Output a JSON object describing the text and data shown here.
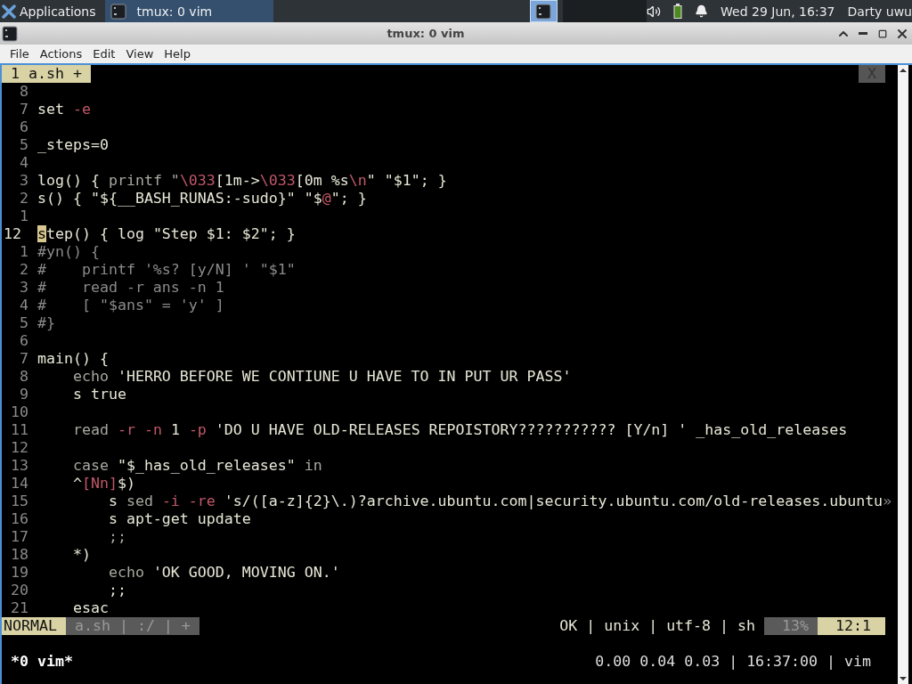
{
  "panel": {
    "app_menu": "Applications",
    "tasks": [
      {
        "label": "tmux: 0 vim",
        "selected": true
      }
    ],
    "clock": "Wed 29 Jun, 16:37",
    "user": "Darty uwu"
  },
  "window": {
    "title": "tmux: 0 vim"
  },
  "menu": [
    "File",
    "Actions",
    "Edit",
    "View",
    "Help"
  ],
  "vim": {
    "tabs": [
      {
        "label": "1 a.sh +",
        "selected": true
      }
    ],
    "close_tab": "X",
    "lines": [
      {
        "number": "8",
        "current": false
      },
      {
        "number": "7",
        "current": false,
        "segments": [
          {
            "kind": "text",
            "text": "set "
          },
          {
            "kind": "flag",
            "text": "-e"
          }
        ]
      },
      {
        "number": "6",
        "current": false
      },
      {
        "number": "5",
        "current": false,
        "segments": [
          {
            "kind": "text",
            "text": "_steps=0"
          }
        ]
      },
      {
        "number": "4",
        "current": false
      },
      {
        "number": "3",
        "current": false,
        "segments": [
          {
            "kind": "text",
            "text": "log() { "
          },
          {
            "kind": "builtin",
            "text": "printf \""
          },
          {
            "kind": "flag",
            "text": "\\033"
          },
          {
            "kind": "text",
            "text": "[1m->"
          },
          {
            "kind": "flag",
            "text": "\\033"
          },
          {
            "kind": "text",
            "text": "[0m %s"
          },
          {
            "kind": "flag",
            "text": "\\n"
          },
          {
            "kind": "text",
            "text": "\" \"$1\"; }"
          }
        ]
      },
      {
        "number": "2",
        "current": false,
        "segments": [
          {
            "kind": "text",
            "text": "s() { \"${__BASH_RUNAS:-sudo}\" \"$"
          },
          {
            "kind": "flag",
            "text": "@"
          },
          {
            "kind": "text",
            "text": "\"; }"
          }
        ]
      },
      {
        "number": "1",
        "current": false
      },
      {
        "number": "12",
        "current": true,
        "segments": [
          {
            "kind": "cursor",
            "text": "s"
          },
          {
            "kind": "text",
            "text": "tep() { log \"Step $1: $2\"; }"
          }
        ]
      },
      {
        "number": "1",
        "current": false,
        "segments": [
          {
            "kind": "comment",
            "text": "#yn() {"
          }
        ]
      },
      {
        "number": "2",
        "current": false,
        "segments": [
          {
            "kind": "comment",
            "text": "#    printf '%s? [y/N] ' \"$1\""
          }
        ]
      },
      {
        "number": "3",
        "current": false,
        "segments": [
          {
            "kind": "comment",
            "text": "#    read -r ans -n 1"
          }
        ]
      },
      {
        "number": "4",
        "current": false,
        "segments": [
          {
            "kind": "comment",
            "text": "#    [ \"$ans\" = 'y' ]"
          }
        ]
      },
      {
        "number": "5",
        "current": false,
        "segments": [
          {
            "kind": "comment",
            "text": "#}"
          }
        ]
      },
      {
        "number": "6",
        "current": false
      },
      {
        "number": "7",
        "current": false,
        "segments": [
          {
            "kind": "text",
            "text": "main() {"
          }
        ]
      },
      {
        "number": "8",
        "current": false,
        "segments": [
          {
            "kind": "builtin",
            "text": "    echo "
          },
          {
            "kind": "text",
            "text": "'HERRO BEFORE WE CONTIUNE U HAVE TO IN PUT UR PASS'"
          }
        ]
      },
      {
        "number": "9",
        "current": false,
        "segments": [
          {
            "kind": "text",
            "text": "    s true"
          }
        ]
      },
      {
        "number": "10",
        "current": false
      },
      {
        "number": "11",
        "current": false,
        "segments": [
          {
            "kind": "builtin",
            "text": "    read "
          },
          {
            "kind": "flag",
            "text": "-r "
          },
          {
            "kind": "flag",
            "text": "-n"
          },
          {
            "kind": "text",
            "text": " 1 "
          },
          {
            "kind": "flag",
            "text": "-p"
          },
          {
            "kind": "text",
            "text": " 'DO U HAVE OLD-RELEASES REPOISTORY??????????? [Y/n] ' _has_old_releases"
          }
        ]
      },
      {
        "number": "12",
        "current": false
      },
      {
        "number": "13",
        "current": false,
        "segments": [
          {
            "kind": "builtin",
            "text": "    case "
          },
          {
            "kind": "text",
            "text": "\"$_has_old_releases\""
          },
          {
            "kind": "builtin",
            "text": " in"
          }
        ]
      },
      {
        "number": "14",
        "current": false,
        "segments": [
          {
            "kind": "text",
            "text": "    ^"
          },
          {
            "kind": "flag",
            "text": "[Nn]"
          },
          {
            "kind": "text",
            "text": "$)"
          }
        ]
      },
      {
        "number": "15",
        "current": false,
        "segments": [
          {
            "kind": "text",
            "text": "        s "
          },
          {
            "kind": "builtin",
            "text": "sed "
          },
          {
            "kind": "flag",
            "text": "-i "
          },
          {
            "kind": "flag",
            "text": "-re"
          },
          {
            "kind": "text",
            "text": " 's/([a-z]{2}\\.)?archive.ubuntu.com|security.ubuntu.com/old-releases.ubuntu"
          },
          {
            "kind": "comment",
            "text": "»"
          }
        ]
      },
      {
        "number": "16",
        "current": false,
        "segments": [
          {
            "kind": "text",
            "text": "        s apt-get update"
          }
        ]
      },
      {
        "number": "17",
        "current": false,
        "segments": [
          {
            "kind": "builtin",
            "text": "        ;;"
          }
        ]
      },
      {
        "number": "18",
        "current": false,
        "segments": [
          {
            "kind": "text",
            "text": "    *)"
          }
        ]
      },
      {
        "number": "19",
        "current": false,
        "segments": [
          {
            "kind": "builtin",
            "text": "        echo "
          },
          {
            "kind": "text",
            "text": "'OK GOOD, MOVING ON.'"
          }
        ]
      },
      {
        "number": "20",
        "current": false,
        "segments": [
          {
            "kind": "text",
            "text": "        ;;"
          }
        ]
      },
      {
        "number": "21",
        "current": false,
        "segments": [
          {
            "kind": "text",
            "text": "    esac"
          }
        ]
      }
    ],
    "statusline": {
      "mode": "NORMAL",
      "file_info": "a.sh | :/ | +",
      "file_format": "OK | unix | utf-8 | sh",
      "percent": "13%",
      "position": "12:1"
    }
  },
  "tmux_status": {
    "windows": "*0 vim*",
    "right": "0.00 0.04 0.03 | 16:37:00 | vim"
  }
}
